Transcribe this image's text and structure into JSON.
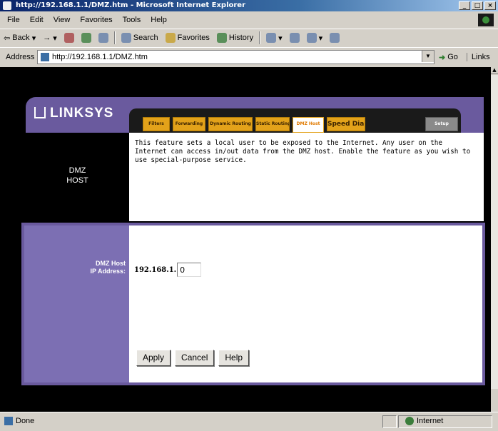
{
  "window": {
    "title": "http://192.168.1.1/DMZ.htm - Microsoft Internet Explorer"
  },
  "menu": [
    "File",
    "Edit",
    "View",
    "Favorites",
    "Tools",
    "Help"
  ],
  "toolbar": {
    "back": "Back",
    "forward": "→",
    "search": "Search",
    "favorites": "Favorites",
    "history": "History"
  },
  "address": {
    "label": "Address",
    "url": "http://192.168.1.1/DMZ.htm",
    "go": "Go",
    "links": "Links"
  },
  "page": {
    "logo": "LINKSYS",
    "tabs": [
      {
        "label": "Filters"
      },
      {
        "label": "Forwarding"
      },
      {
        "label": "Dynamic Routing"
      },
      {
        "label": "Static Routing"
      },
      {
        "label": "DMZ Host"
      },
      {
        "label": "Speed Dial"
      },
      {
        "label": "Setup"
      }
    ],
    "section_title_line1": "DMZ",
    "section_title_line2": "HOST",
    "description": "This feature sets a local user to be exposed to the Internet. Any user on the Internet can access in/out data from the DMZ host. Enable the feature as you wish to use special-purpose service.",
    "field_label_line1": "DMZ Host",
    "field_label_line2": "IP Address:",
    "ip_prefix": "192.168.1.",
    "ip_value": "0",
    "buttons": {
      "apply": "Apply",
      "cancel": "Cancel",
      "help": "Help"
    }
  },
  "status": {
    "left": "Done",
    "zone": "Internet"
  },
  "colors": {
    "brand_purple": "#6a5a9e",
    "form_purple": "#7c6fb3",
    "tab_orange": "#e3a21a"
  }
}
